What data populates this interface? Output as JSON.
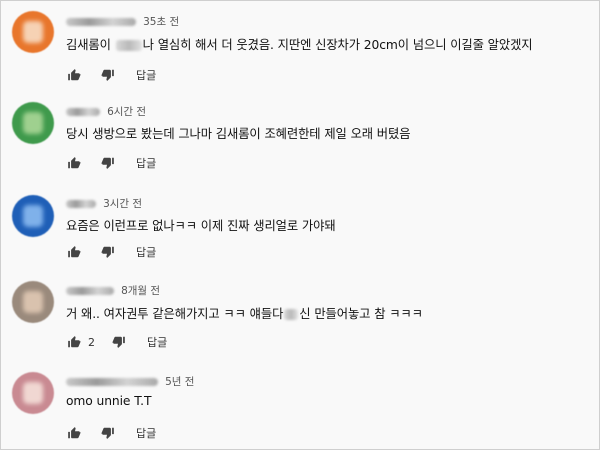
{
  "comments": [
    {
      "time": "35초 전",
      "text_before": "김새롬이 ",
      "text_after": "나 열심히 해서 더 웃겼음. 지딴엔 신장차가 20cm이 넘으니 이길줄 알았겠지",
      "likes": "",
      "reply_label": "답글",
      "avatar_color": "#e8762c"
    },
    {
      "time": "6시간 전",
      "text_before": "당시 생방으로 봤는데 그나마 김새롬이 조혜련한테 제일 오래 버텼음",
      "text_after": "",
      "likes": "",
      "reply_label": "답글",
      "avatar_color": "#3f9a4c"
    },
    {
      "time": "3시간 전",
      "text_before": "요즘은 이런프로 없나ㅋㅋ 이제 진짜 생리얼로 가야돼",
      "text_after": "",
      "likes": "",
      "reply_label": "답글",
      "avatar_color": "#1f5fb7"
    },
    {
      "time": "8개월 전",
      "text_before": "거 왜.. 여자권투 같은해가지고 ㅋㅋ 얘들다",
      "text_after": "신 만들어놓고 참 ㅋㅋㅋ",
      "likes": "2",
      "reply_label": "답글",
      "avatar_color": "#9a8a7c"
    },
    {
      "time": "5년 전",
      "text_before": "omo unnie T.T",
      "text_after": "",
      "likes": "",
      "reply_label": "답글",
      "avatar_color": "#c98a92"
    }
  ],
  "icons": {
    "like": "thumbs-up-icon",
    "dislike": "thumbs-down-icon"
  }
}
